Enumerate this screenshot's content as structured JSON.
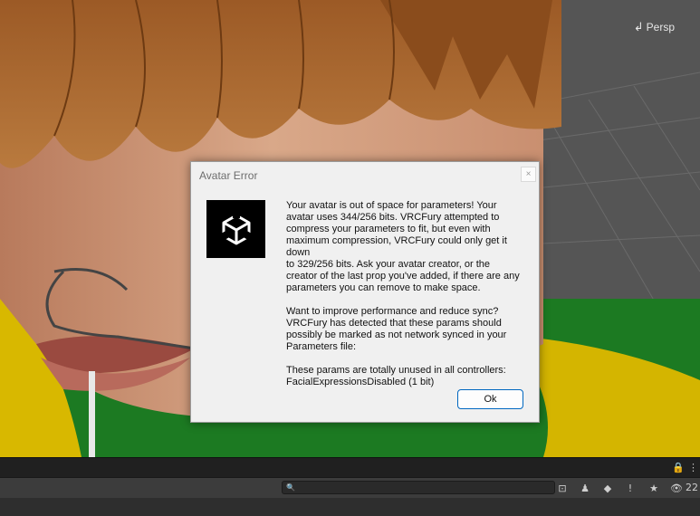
{
  "scene": {
    "camera_mode_label": "Persp",
    "camera_mode_icon": "perspective-arrow-icon"
  },
  "dialog": {
    "title": "Avatar Error",
    "close_glyph": "×",
    "logo_icon": "unity-cube-logo-icon",
    "message": "Your avatar is out of space for parameters! Your\navatar uses 344/256 bits. VRCFury attempted to\ncompress your parameters to fit, but even with\nmaximum compression, VRCFury could only get it down\nto 329/256 bits. Ask your avatar creator, or the\ncreator of the last prop you've added, if there are any\nparameters you can remove to make space.\n\nWant to improve performance and reduce sync?\nVRCFury has detected that these params should\npossibly be marked as not network synced in your\nParameters file:\n\nThese params are totally unused in all controllers:\nFacialExpressionsDisabled (1 bit)",
    "ok_label": "Ok"
  },
  "bottom_panel": {
    "lock_glyph": "🔒",
    "menu_glyph": "⋮",
    "search_icon": "magnifier-icon",
    "search_glyph": "🔍",
    "search_placeholder": "",
    "toolbar_icons": [
      {
        "name": "search-by-type-icon",
        "glyph": "⊡"
      },
      {
        "name": "asset-label-icon",
        "glyph": "♟"
      },
      {
        "name": "tag-icon",
        "glyph": "◆"
      },
      {
        "name": "warning-icon",
        "glyph": "!"
      },
      {
        "name": "favorite-star-icon",
        "glyph": "★"
      },
      {
        "name": "hidden-eye-icon",
        "glyph": "👁"
      }
    ],
    "hidden_count": "22"
  }
}
